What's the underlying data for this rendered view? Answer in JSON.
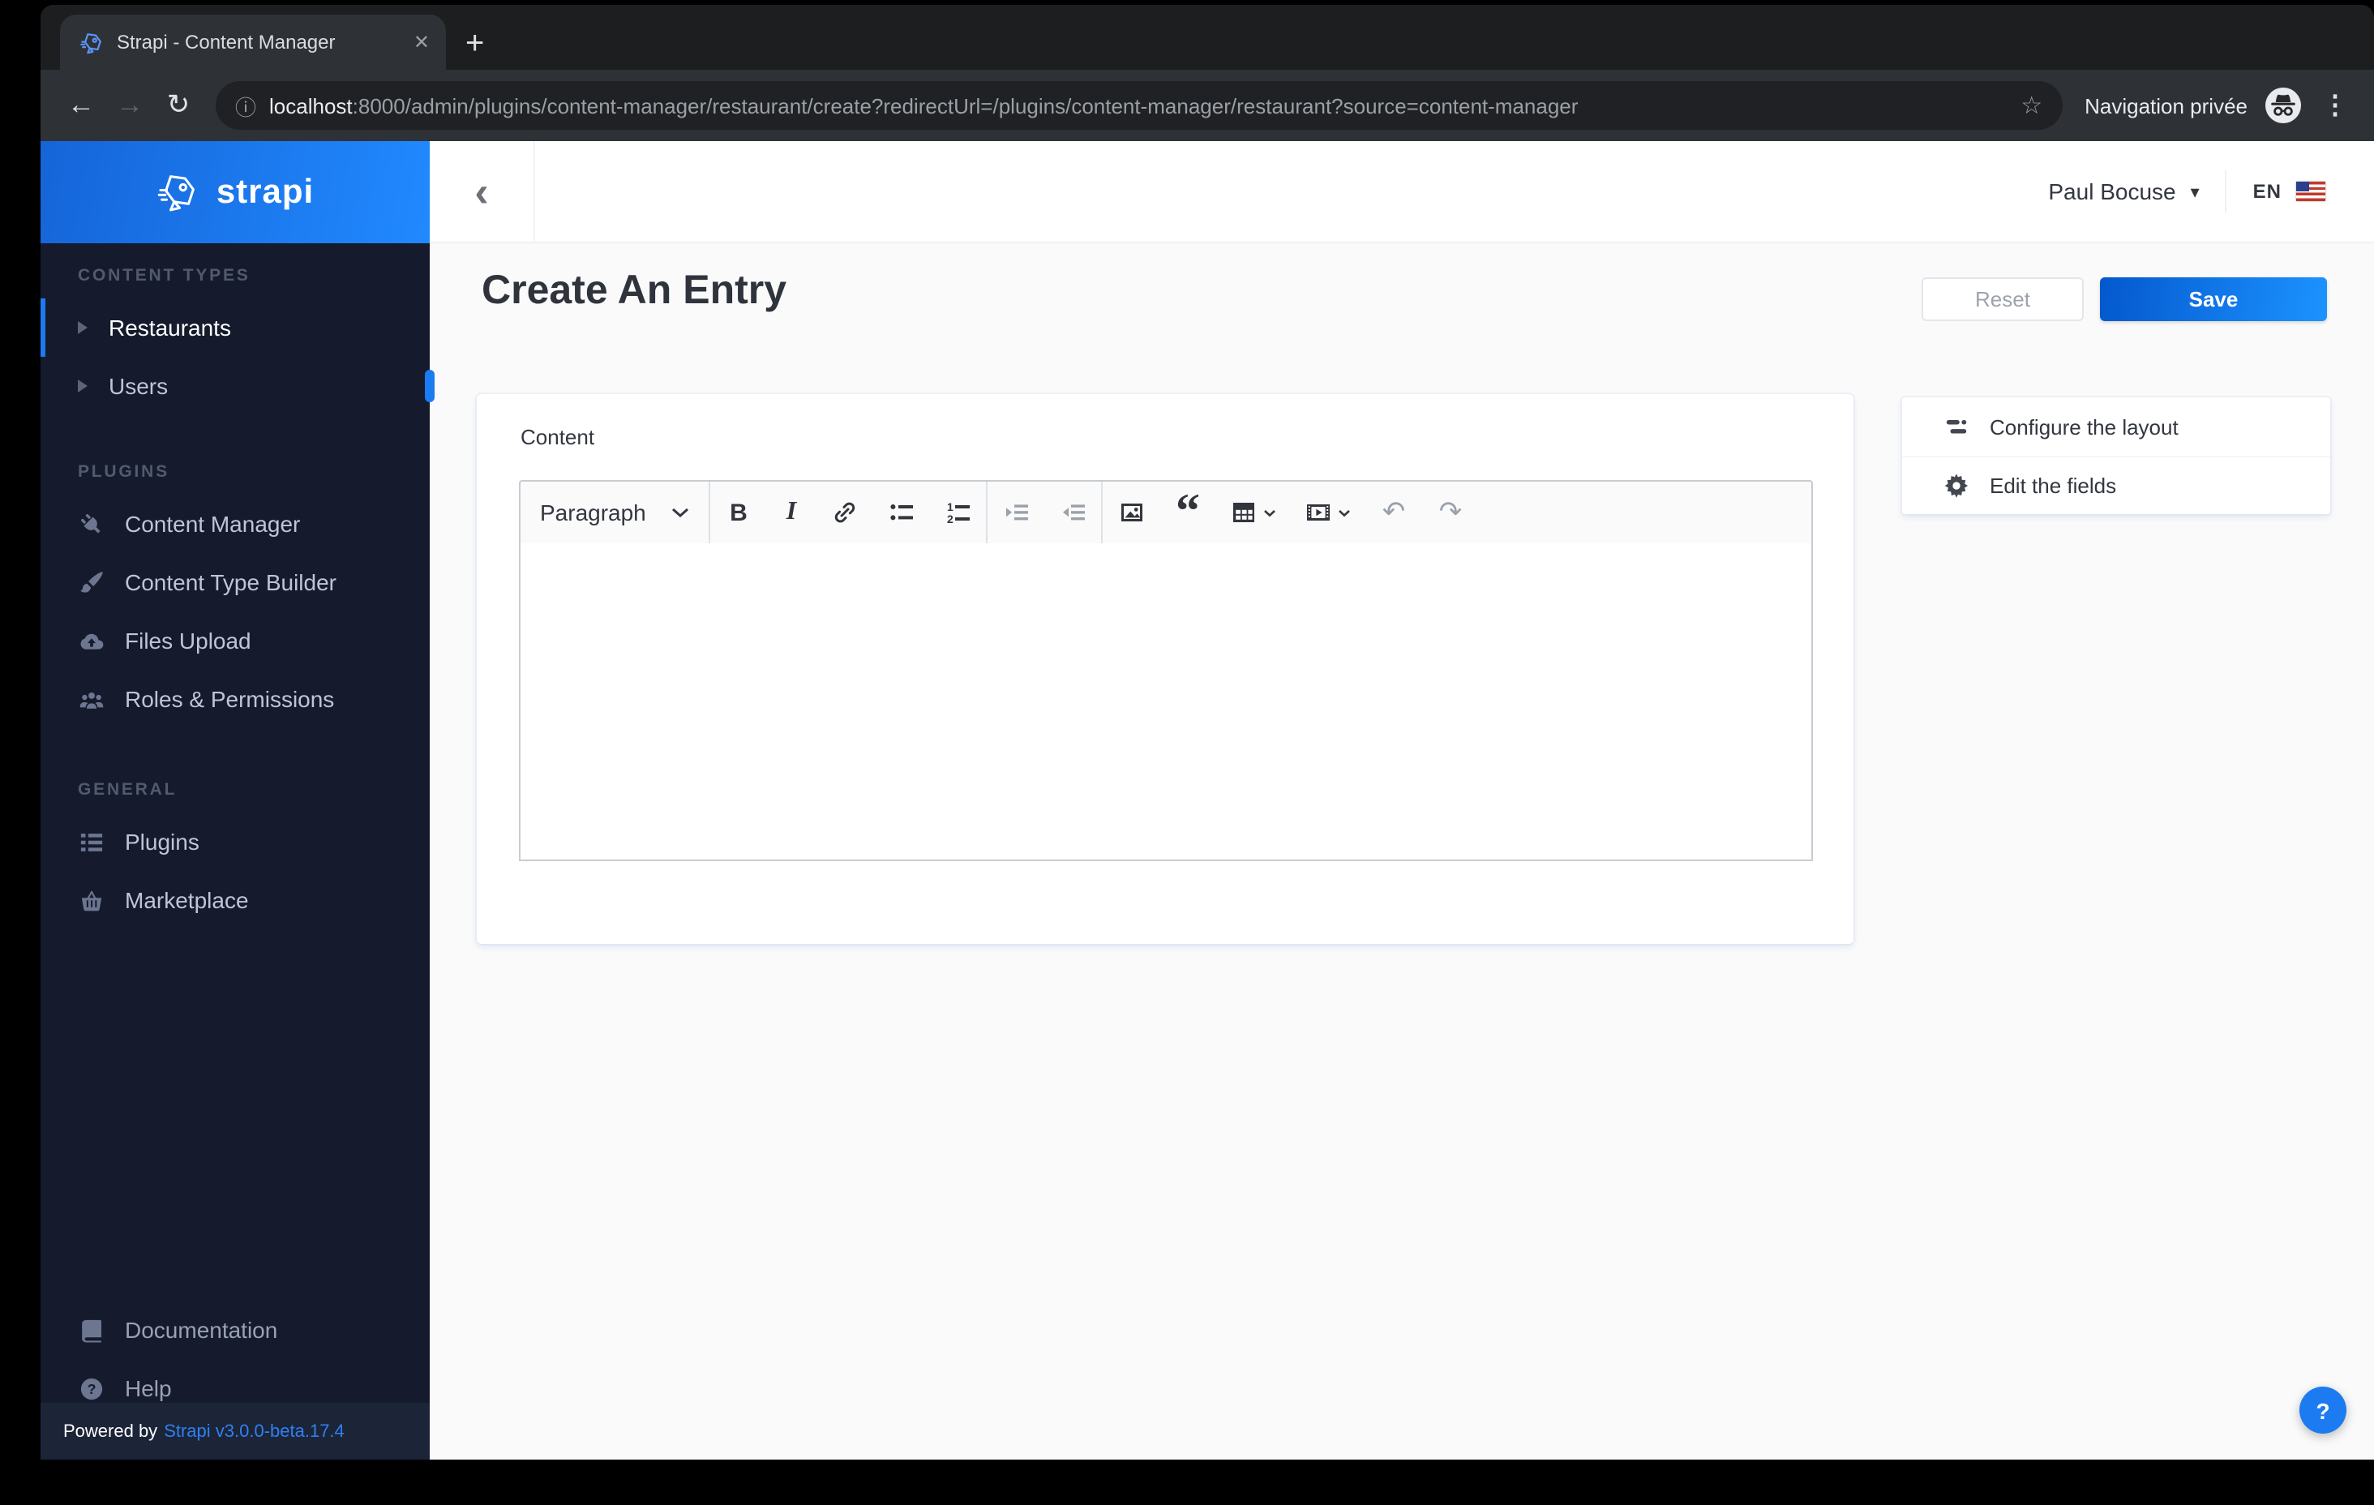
{
  "browser": {
    "tab_title": "Strapi - Content Manager",
    "url": {
      "host": "localhost",
      "rest": ":8000/admin/plugins/content-manager/restaurant/create?redirectUrl=/plugins/content-manager/restaurant?source=content-manager"
    },
    "private_label": "Navigation privée"
  },
  "sidebar": {
    "brand": "strapi",
    "sections": [
      {
        "title": "CONTENT TYPES",
        "items": [
          {
            "label": "Restaurants"
          },
          {
            "label": "Users"
          }
        ]
      },
      {
        "title": "PLUGINS",
        "items": [
          {
            "label": "Content Manager"
          },
          {
            "label": "Content Type Builder"
          },
          {
            "label": "Files Upload"
          },
          {
            "label": "Roles & Permissions"
          }
        ]
      },
      {
        "title": "GENERAL",
        "items": [
          {
            "label": "Plugins"
          },
          {
            "label": "Marketplace"
          }
        ]
      }
    ],
    "bottom_items": [
      {
        "label": "Documentation"
      },
      {
        "label": "Help"
      }
    ],
    "powered_by": "Powered by",
    "version": "Strapi v3.0.0-beta.17.4"
  },
  "header": {
    "user": "Paul Bocuse",
    "locale": "EN"
  },
  "page": {
    "title": "Create An Entry",
    "reset": "Reset",
    "save": "Save"
  },
  "editor": {
    "field_label": "Content",
    "paragraph": "Paragraph",
    "bold": "B",
    "italic": "I",
    "num1": "1",
    "num2": "2",
    "quote_glyph": "“",
    "undo_glyph": "↶",
    "redo_glyph": "↷"
  },
  "panel": {
    "configure": "Configure the layout",
    "edit": "Edit the fields"
  },
  "help": {
    "label": "?"
  },
  "colors": {
    "accent": "#1c7bf1",
    "save_gradient_start": "#0458ce",
    "save_gradient_end": "#1c93ff",
    "sidebar_bg": "#151b2d",
    "version_link": "#2f80f0"
  }
}
